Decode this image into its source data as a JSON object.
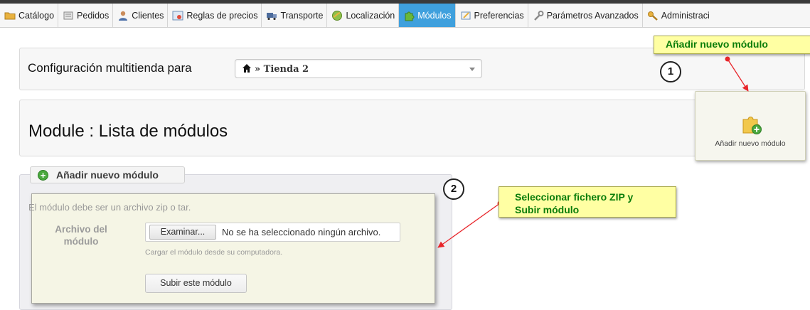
{
  "nav": {
    "tabs": [
      {
        "label": "Catálogo",
        "icon": "folder-icon"
      },
      {
        "label": "Pedidos",
        "icon": "cart-icon"
      },
      {
        "label": "Clientes",
        "icon": "users-icon"
      },
      {
        "label": "Reglas de precios",
        "icon": "price-rules-icon"
      },
      {
        "label": "Transporte",
        "icon": "truck-icon"
      },
      {
        "label": "Localización",
        "icon": "globe-icon"
      },
      {
        "label": "Módulos",
        "icon": "puzzle-icon",
        "active": true
      },
      {
        "label": "Preferencias",
        "icon": "preferences-icon"
      },
      {
        "label": "Parámetros Avanzados",
        "icon": "wrench-icon"
      },
      {
        "label": "Administraci",
        "icon": "key-icon"
      }
    ],
    "active_color": "#3fa0dd"
  },
  "multistore": {
    "label": "Configuración multitienda para",
    "selected_shop": "» Tienda 2"
  },
  "header": {
    "title": "Module : Lista de módulos",
    "add_module_button": "Añadir nuevo módulo"
  },
  "annotations": {
    "note_top": "Añadir nuevo módulo",
    "note_middle_line1": "Seleccionar fichero ZIP y",
    "note_middle_line2": "Subir módulo",
    "step1": "1",
    "step2": "2",
    "note_color": "#ffffa3",
    "text_color": "#0a7d0a",
    "arrow_color": "#e8262b"
  },
  "upload_form": {
    "legend": "Añadir nuevo módulo",
    "description": "El módulo debe ser un archivo zip o tar.",
    "file_label_line1": "Archivo del",
    "file_label_line2": "módulo",
    "browse_button": "Examinar...",
    "no_file_text": "No se ha seleccionado ningún archivo.",
    "hint": "Cargar el módulo desde su computadora.",
    "submit_button": "Subir este módulo"
  }
}
